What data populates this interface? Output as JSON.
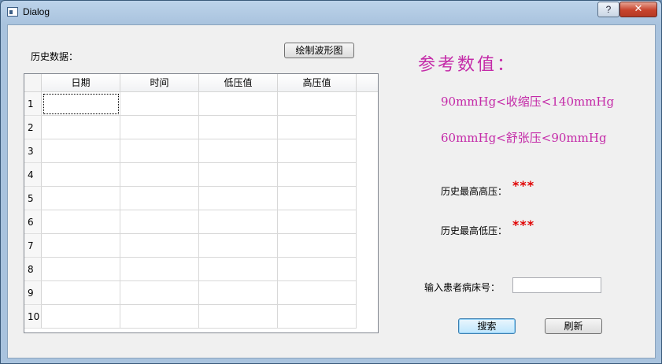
{
  "window": {
    "title": "Dialog",
    "help_label": "?",
    "close_label": "✕"
  },
  "left": {
    "history_label": "历史数据：",
    "draw_button": "绘制波形图"
  },
  "table": {
    "columns": [
      "日期",
      "时间",
      "低压值",
      "高压值"
    ],
    "rows": [
      "1",
      "2",
      "3",
      "4",
      "5",
      "6",
      "7",
      "8",
      "9",
      "10"
    ]
  },
  "reference": {
    "heading": "参考数值：",
    "systolic_range": "90mmHg<收缩压<140mmHg",
    "diastolic_range": "60mmHg<舒张压<90mmHg"
  },
  "stats": {
    "max_high_label": "历史最高高压：",
    "max_high_value": "***",
    "max_low_label": "历史最高低压：",
    "max_low_value": "***"
  },
  "search": {
    "label": "输入患者病床号：",
    "value": "",
    "search_button": "搜索",
    "refresh_button": "刷新"
  },
  "colors": {
    "accent_text": "#c42aa8",
    "value_red": "#e00000"
  }
}
